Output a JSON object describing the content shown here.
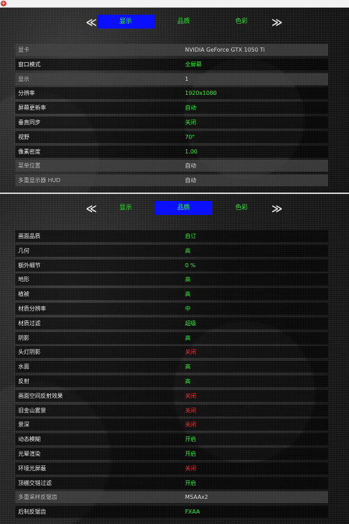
{
  "panels": [
    {
      "tabs": [
        "显示",
        "品质",
        "色彩"
      ],
      "active_tab": 0,
      "rows": [
        {
          "label": "显卡",
          "value": "NVIDIA GeForce GTX 1050 Ti",
          "color": "white",
          "dim": true
        },
        {
          "label": "窗口模式",
          "value": "全屏幕",
          "color": "green",
          "dim": false
        },
        {
          "label": "显示",
          "value": "1",
          "color": "white",
          "dim": true
        },
        {
          "label": "分辨率",
          "value": "1920x1080",
          "color": "green",
          "dim": false
        },
        {
          "label": "屏幕更新率",
          "value": "自动",
          "color": "green",
          "dim": false
        },
        {
          "label": "垂直同步",
          "value": "关闭",
          "color": "green",
          "dim": false
        },
        {
          "label": "视野",
          "value": "70°",
          "color": "green",
          "dim": false
        },
        {
          "label": "像素密度",
          "value": "1.00",
          "color": "green",
          "dim": false
        },
        {
          "label": "菜单位置",
          "value": "自动",
          "color": "white",
          "dim": true
        },
        {
          "label": "多重显示器 HUD",
          "value": "自动",
          "color": "white",
          "dim": true
        }
      ]
    },
    {
      "tabs": [
        "显示",
        "品质",
        "色彩"
      ],
      "active_tab": 1,
      "rows": [
        {
          "label": "画面品质",
          "value": "自订",
          "color": "green",
          "dim": false
        },
        {
          "label": "几何",
          "value": "高",
          "color": "green",
          "dim": false
        },
        {
          "label": "额外细节",
          "value": "0 %",
          "color": "green",
          "dim": false
        },
        {
          "label": "地形",
          "value": "高",
          "color": "green",
          "dim": false
        },
        {
          "label": "植被",
          "value": "高",
          "color": "green",
          "dim": false
        },
        {
          "label": "材质分辨率",
          "value": "中",
          "color": "green",
          "dim": false
        },
        {
          "label": "材质过滤",
          "value": "超级",
          "color": "green",
          "dim": false
        },
        {
          "label": "阴影",
          "value": "高",
          "color": "green",
          "dim": false
        },
        {
          "label": "头灯阴影",
          "value": "关闭",
          "color": "red",
          "dim": false
        },
        {
          "label": "水面",
          "value": "高",
          "color": "green",
          "dim": false
        },
        {
          "label": "反射",
          "value": "高",
          "color": "green",
          "dim": false
        },
        {
          "label": "画面空间反射效果",
          "value": "关闭",
          "color": "red",
          "dim": false
        },
        {
          "label": "旧金山雾景",
          "value": "关闭",
          "color": "red",
          "dim": false
        },
        {
          "label": "景深",
          "value": "关闭",
          "color": "red",
          "dim": false
        },
        {
          "label": "动态模糊",
          "value": "开启",
          "color": "green",
          "dim": false
        },
        {
          "label": "光晕渲染",
          "value": "开启",
          "color": "green",
          "dim": false
        },
        {
          "label": "环境光屏蔽",
          "value": "关闭",
          "color": "red",
          "dim": false
        },
        {
          "label": "顶棚交错过滤",
          "value": "开启",
          "color": "green",
          "dim": false
        },
        {
          "label": "多重采样反锯齿",
          "value": "MSAAx2",
          "color": "white",
          "dim": true
        },
        {
          "label": "后制反锯齿",
          "value": "FXAA",
          "color": "green",
          "dim": false
        }
      ]
    }
  ]
}
